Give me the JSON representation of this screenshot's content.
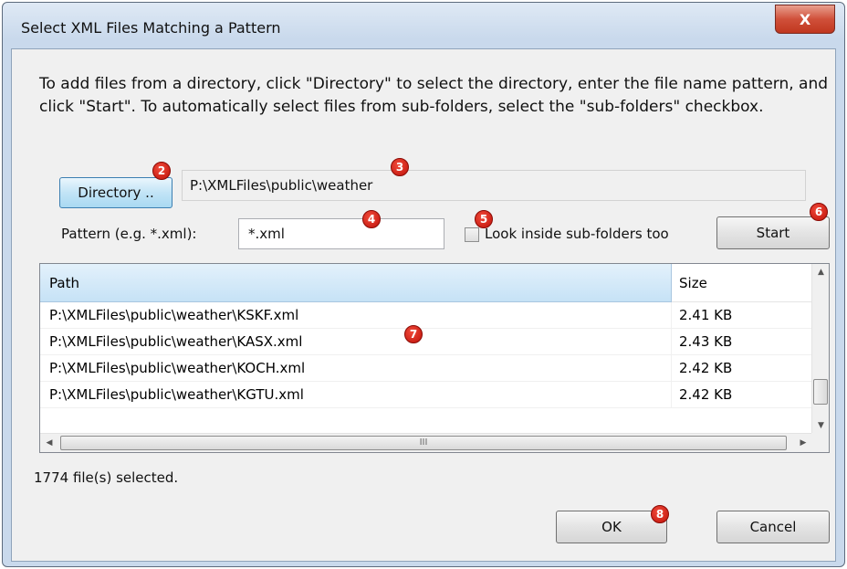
{
  "window": {
    "title": "Select XML Files Matching a Pattern",
    "close_label": "X"
  },
  "instructions": "To add files from a directory, click \"Directory\" to select the directory, enter the file name pattern, and click \"Start\". To automatically select files from sub-folders, select the \"sub-folders\" checkbox.",
  "directory": {
    "button_label": "Directory ..",
    "path": "P:\\XMLFiles\\public\\weather"
  },
  "pattern": {
    "label": "Pattern (e.g. *.xml):",
    "value": "*.xml"
  },
  "subfolders": {
    "label": "Look inside sub-folders too",
    "checked": false
  },
  "start_label": "Start",
  "table": {
    "columns": [
      "Path",
      "Size"
    ],
    "rows": [
      {
        "path": "P:\\XMLFiles\\public\\weather\\KSKF.xml",
        "size": "2.41 KB"
      },
      {
        "path": "P:\\XMLFiles\\public\\weather\\KASX.xml",
        "size": "2.43 KB"
      },
      {
        "path": "P:\\XMLFiles\\public\\weather\\KOCH.xml",
        "size": "2.42 KB"
      },
      {
        "path": "P:\\XMLFiles\\public\\weather\\KGTU.xml",
        "size": "2.42 KB"
      }
    ],
    "hscroll_grip": "III"
  },
  "status": "1774 file(s) selected.",
  "buttons": {
    "ok": "OK",
    "cancel": "Cancel"
  },
  "callouts": [
    "2",
    "3",
    "4",
    "5",
    "6",
    "7",
    "8"
  ],
  "colors": {
    "callout": "#d0160c",
    "header_highlight": "#c6e2f6",
    "title_bar": "#c9d9ec"
  }
}
